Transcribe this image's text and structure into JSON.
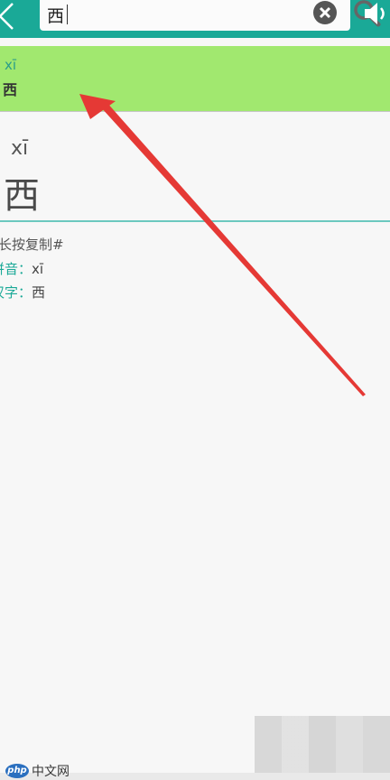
{
  "search": {
    "query": "西"
  },
  "icons": {
    "back": "chevron-left-icon",
    "clear": "close-circle-icon",
    "search": "search-icon",
    "speaker": "speaker-icon"
  },
  "suggestion": {
    "pinyin": "xī",
    "char": "西"
  },
  "detail": {
    "pinyin": "xī",
    "char": "西",
    "copy_hint": "长按复制#",
    "pinyin_label": "拼音：",
    "pinyin_value": "xī",
    "char_label": "汉字：",
    "char_value": "西"
  },
  "watermark": {
    "logo": "php",
    "text": "中文网"
  },
  "colors": {
    "topbar": "#1aa997",
    "suggestion_bg": "#a1e86f",
    "accent": "#1aa997",
    "arrow": "#e53935"
  }
}
